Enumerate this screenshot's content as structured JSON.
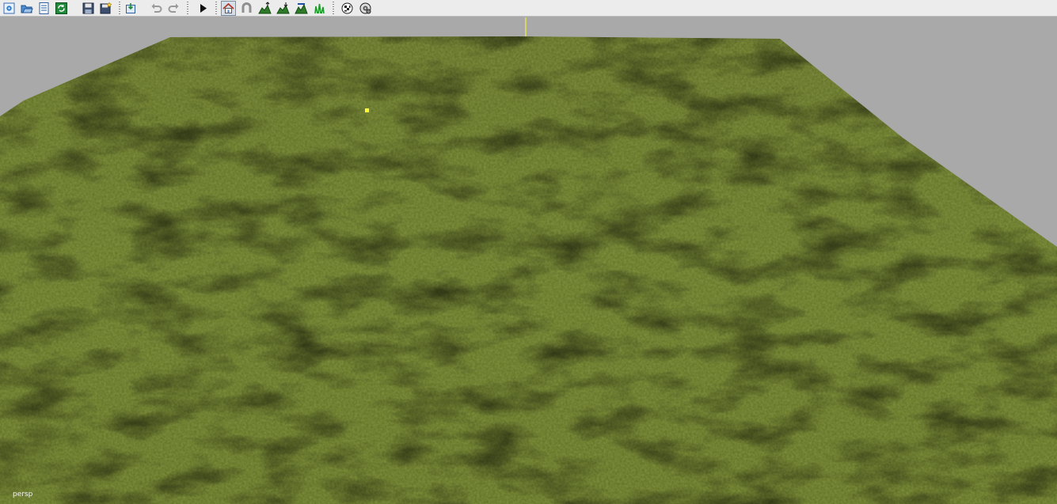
{
  "toolbar": {
    "buttons": [
      {
        "name": "new-scene-button",
        "icon": "gear-doc-icon",
        "pressed": false
      },
      {
        "name": "open-scene-button",
        "icon": "open-folder-icon",
        "pressed": false
      },
      {
        "name": "file-list-button",
        "icon": "list-document-icon",
        "pressed": false
      },
      {
        "name": "refresh-button",
        "icon": "refresh-icon",
        "pressed": false
      },
      {
        "name": "save-button",
        "icon": "floppy-icon",
        "pressed": false
      },
      {
        "name": "save-as-button",
        "icon": "floppy-star-icon",
        "pressed": false
      },
      {
        "name": "import-button",
        "icon": "import-box-icon",
        "pressed": false
      },
      {
        "name": "undo-button",
        "icon": "undo-icon",
        "pressed": false,
        "disabled": true
      },
      {
        "name": "redo-button",
        "icon": "redo-icon",
        "pressed": false,
        "disabled": true
      },
      {
        "name": "play-button",
        "icon": "play-icon",
        "pressed": false
      },
      {
        "name": "home-mode-button",
        "icon": "house-icon",
        "pressed": true
      },
      {
        "name": "magnet-mode-button",
        "icon": "magnet-icon",
        "pressed": false
      },
      {
        "name": "raise-terrain-button",
        "icon": "terrain-raise-icon",
        "pressed": false
      },
      {
        "name": "lower-terrain-button",
        "icon": "terrain-lower-icon",
        "pressed": false
      },
      {
        "name": "smooth-terrain-button",
        "icon": "terrain-smooth-icon",
        "pressed": false
      },
      {
        "name": "paint-grass-button",
        "icon": "grass-icon",
        "pressed": false
      },
      {
        "name": "render-settings-button",
        "icon": "checker-cog-icon",
        "pressed": false
      },
      {
        "name": "render-options-button",
        "icon": "cog-circle-icon",
        "pressed": false
      }
    ]
  },
  "viewport": {
    "camera_label": "persp",
    "background_color": "#a9a9a9",
    "terrain_color": "#5f7024",
    "selection_color": "#ffff33"
  }
}
